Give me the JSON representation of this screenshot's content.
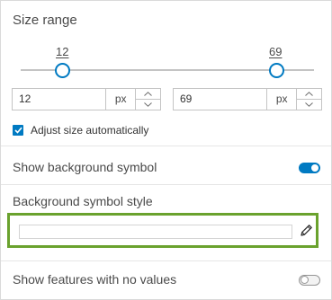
{
  "size_range": {
    "title": "Size range",
    "min_value": "12",
    "max_value": "69",
    "min_input": "12",
    "max_input": "69",
    "unit": "px"
  },
  "adjust_size": {
    "label": "Adjust size automatically",
    "checked": true
  },
  "background_symbol": {
    "label": "Show background symbol",
    "enabled": true,
    "style_title": "Background symbol style"
  },
  "no_values": {
    "label": "Show features with no values",
    "enabled": false
  },
  "colors": {
    "accent": "#007ac2",
    "highlight": "#6aa22e"
  },
  "icons": [
    "pencil-icon",
    "chevron-up-icon",
    "chevron-down-icon",
    "checkmark-icon"
  ]
}
